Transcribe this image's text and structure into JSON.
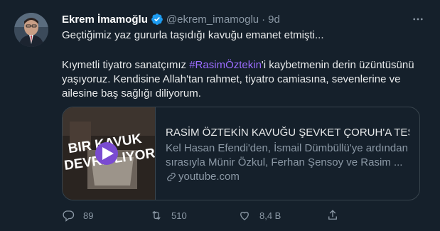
{
  "author": {
    "name": "Ekrem İmamoğlu",
    "handle": "@ekrem_imamoglu",
    "separator": "·",
    "time": "9d"
  },
  "tweet": {
    "line1": "Geçtiğimiz yaz gururla taşıdığı kavuğu emanet etmişti...",
    "line2_pre": "Kıymetli tiyatro sanatçımız ",
    "hashtag": "#RasimÖztekin",
    "line2_post": "'i kaybetmenin derin üzüntüsünü yaşıyoruz. Kendisine Allah'tan rahmet, tiyatro camiasına, sevenlerine ve ailesine baş sağlığı diliyorum."
  },
  "card": {
    "thumb_text_line1": "BIR KAVUK",
    "thumb_text_line2": "DEVRE  LIYOR",
    "title": "RASİM ÖZTEKİN KAVUĞU ŞEVKET ÇORUH'A TESLİ...",
    "description": "Kel Hasan Efendi'den, İsmail Dümbüllü'ye ardından sırasıyla Münir Özkul, Ferhan Şensoy ve Rasim ...",
    "source": "youtube.com"
  },
  "actions": {
    "replies": "89",
    "retweets": "510",
    "likes": "8,4 B"
  },
  "colors": {
    "background": "#15202b",
    "hashtag": "#9b6cff",
    "muted": "#8b98a5",
    "verified": "#1d9bf0",
    "play_button": "#7a4bd1"
  }
}
